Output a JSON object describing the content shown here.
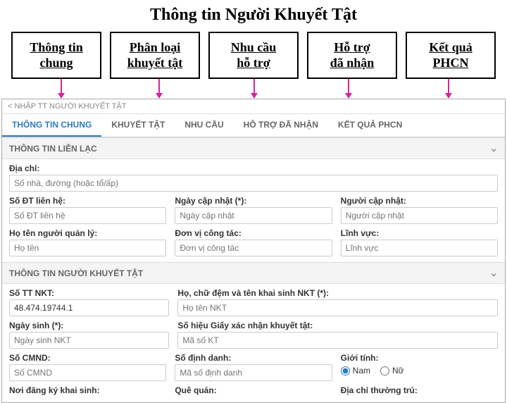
{
  "title": "Thông tin Người Khuyết Tật",
  "boxes": [
    {
      "l1": "Thông tin",
      "l2": "chung"
    },
    {
      "l1": "Phân loại",
      "l2": "khuyết tật"
    },
    {
      "l1": "Nhu cầu",
      "l2": "hỗ trợ"
    },
    {
      "l1": "Hỗ trợ",
      "l2": "đã nhận"
    },
    {
      "l1": "Kết quả",
      "l2": "PHCN"
    }
  ],
  "breadcrumb": "< NHẬP TT NGƯỜI KHUYẾT TẬT",
  "tabs": [
    "THÔNG TIN CHUNG",
    "KHUYẾT TẬT",
    "NHU CẦU",
    "HỖ TRỢ ĐÃ NHẬN",
    "KẾT QUẢ PHCN"
  ],
  "section1": {
    "title": "THÔNG TIN LIÊN LẠC",
    "dia_chi": {
      "label": "Địa chỉ:",
      "ph": "Số nhà, đường (hoặc tổ/ấp)"
    },
    "sdt": {
      "label": "Số ĐT liên hệ:",
      "ph": "Số ĐT liên hệ"
    },
    "ngay_cap": {
      "label": "Ngày cập nhật (*):",
      "ph": "Ngày cập nhật"
    },
    "nguoi_cap": {
      "label": "Người cập nhật:",
      "ph": "Người cập nhật"
    },
    "ho_ten_ql": {
      "label": "Họ tên người quản lý:",
      "ph": "Họ tên"
    },
    "don_vi": {
      "label": "Đơn vị công tác:",
      "ph": "Đơn vị công tác"
    },
    "linh_vuc": {
      "label": "Lĩnh vực:",
      "ph": "Lĩnh vực"
    }
  },
  "section2": {
    "title": "THÔNG TIN NGƯỜI KHUYẾT TẬT",
    "stt": {
      "label": "Số TT NKT:",
      "value": "48.474.19744.1"
    },
    "ho_ten": {
      "label": "Họ, chữ đệm và tên khai sinh NKT (*):",
      "ph": "Họ tên NKT"
    },
    "ngay_sinh": {
      "label": "Ngày sinh (*):",
      "ph": "Ngày sinh NKT"
    },
    "so_hieu": {
      "label": "Số hiệu Giấy xác nhận khuyết tật:",
      "ph": "Mã số KT"
    },
    "cmnd": {
      "label": "Số CMND:",
      "ph": "Số CMND"
    },
    "so_dinh_danh": {
      "label": "Số định danh:",
      "ph": "Mã số định danh"
    },
    "gioi_tinh": {
      "label": "Giới tính:",
      "opt1": "Nam",
      "opt2": "Nữ"
    },
    "noi_dk": {
      "label": "Nơi đăng ký khai sinh:"
    },
    "que_quan": {
      "label": "Quê quán:"
    },
    "dc_thuong_tru": {
      "label": "Địa chỉ thường trú:"
    }
  }
}
